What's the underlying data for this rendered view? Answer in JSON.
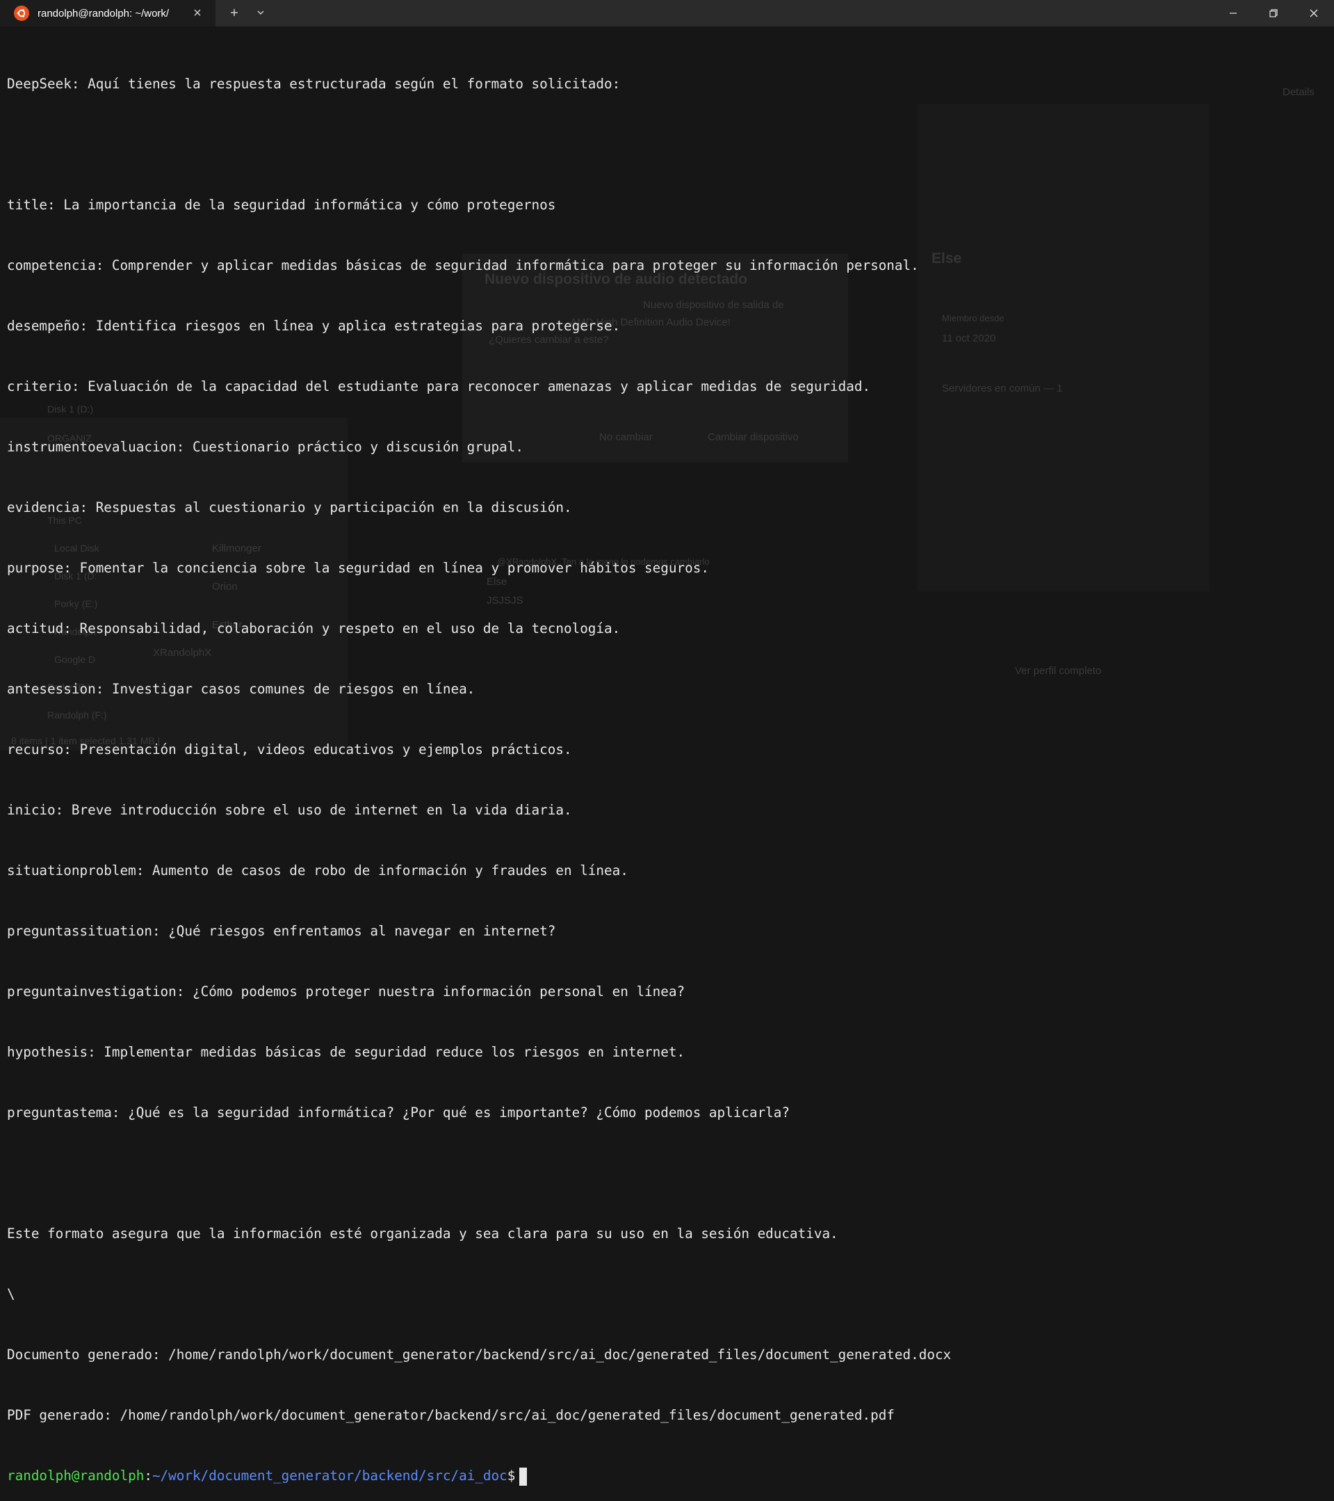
{
  "tab": {
    "title": "randolph@randolph: ~/work/",
    "close": "×",
    "new_tab": "+",
    "dropdown": "⌄"
  },
  "window": {
    "minimize": "—",
    "maximize": "❐",
    "close": "✕"
  },
  "terminal": {
    "lines": [
      "DeepSeek: Aquí tienes la respuesta estructurada según el formato solicitado:",
      "",
      "title: La importancia de la seguridad informática y cómo protegernos",
      "competencia: Comprender y aplicar medidas básicas de seguridad informática para proteger su información personal.",
      "desempeño: Identifica riesgos en línea y aplica estrategias para protegerse.",
      "criterio: Evaluación de la capacidad del estudiante para reconocer amenazas y aplicar medidas de seguridad.",
      "instrumentoevaluacion: Cuestionario práctico y discusión grupal.",
      "evidencia: Respuestas al cuestionario y participación en la discusión.",
      "purpose: Fomentar la conciencia sobre la seguridad en línea y promover hábitos seguros.",
      "actitud: Responsabilidad, colaboración y respeto en el uso de la tecnología.",
      "antesession: Investigar casos comunes de riesgos en línea.",
      "recurso: Presentación digital, videos educativos y ejemplos prácticos.",
      "inicio: Breve introducción sobre el uso de internet en la vida diaria.",
      "situationproblem: Aumento de casos de robo de información y fraudes en línea.",
      "preguntassituation: ¿Qué riesgos enfrentamos al navegar en internet?",
      "preguntainvestigation: ¿Cómo podemos proteger nuestra información personal en línea?",
      "hypothesis: Implementar medidas básicas de seguridad reduce los riesgos en internet.",
      "preguntastema: ¿Qué es la seguridad informática? ¿Por qué es importante? ¿Cómo podemos aplicarla?",
      "",
      "Este formato asegura que la información esté organizada y sea clara para su uso en la sesión educativa.",
      "\\",
      "Documento generado: /home/randolph/work/document_generator/backend/src/ai_doc/generated_files/document_generated.docx",
      "PDF generado: /home/randolph/work/document_generator/backend/src/ai_doc/generated_files/document_generated.pdf"
    ],
    "prompt_user": "randolph@randolph",
    "prompt_sep": ":",
    "prompt_path": "~/work/document_generator/backend/src/ai_doc",
    "prompt_symbol": "$"
  },
  "background": {
    "details_label": "Details",
    "dialog_title": "Nuevo dispositivo de audio detectado",
    "dialog_text_1": "Nuevo dispositivo de salida de",
    "dialog_text_2": "AMD High Definition Audio Device!",
    "dialog_text_3": "¿Quieres cambiar a este?",
    "dialog_cancel": "No cambiar",
    "dialog_confirm": "Cambiar dispositivo",
    "profile_name": "Else",
    "member_since_label": "Miembro desde",
    "member_since_date": "11 oct 2020",
    "servers_common": "Servidores en común — 1",
    "explorer_items": [
      "Disk 1 (D:)",
      "ORGANIZ",
      "This PC",
      "Local Disk",
      "Disk 1 (D:",
      "Porky (E:)",
      "Randolph",
      "Google D",
      "Porky (E:)",
      "Randolph (F:)"
    ],
    "status_bar": "8 items  |  1 item selected  1.31 MB  |",
    "chat_user": "XRandolphX",
    "chat_names": [
      "Killmonger",
      "Orion",
      "Esther"
    ],
    "message_author": "Else",
    "message_text": "JSJSJS",
    "reply_text": "@XRandolphX, Ten a la mano lo podemos cambiarlo",
    "view_profile": "Ver perfil completo"
  }
}
